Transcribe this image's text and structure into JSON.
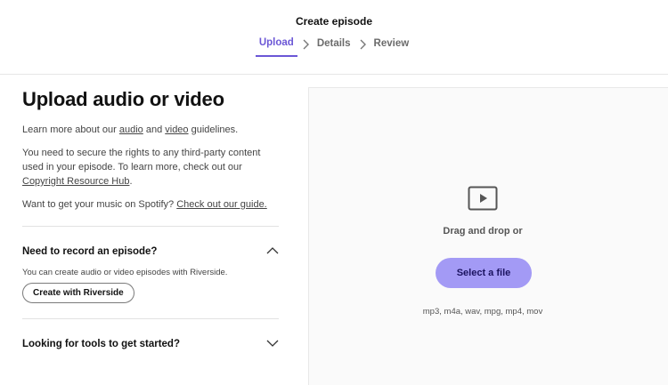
{
  "header": {
    "title": "Create episode",
    "steps": [
      {
        "label": "Upload",
        "active": true
      },
      {
        "label": "Details",
        "active": false
      },
      {
        "label": "Review",
        "active": false
      }
    ]
  },
  "left": {
    "heading": "Upload audio or video",
    "guidelines": {
      "prefix": "Learn more about our ",
      "audio_link": "audio",
      "middle": " and ",
      "video_link": "video",
      "suffix": " guidelines."
    },
    "rights": {
      "text": "You need to secure the rights to any third-party content used in your episode. To learn more, check out our ",
      "link": "Copyright Resource Hub",
      "suffix": "."
    },
    "music": {
      "text": "Want to get your music on Spotify? ",
      "link": "Check out our guide."
    },
    "accordion_record": {
      "title": "Need to record an episode?",
      "expanded": true,
      "body": "You can create audio or video episodes with Riverside.",
      "button": "Create with Riverside"
    },
    "accordion_tools": {
      "title": "Looking for tools to get started?",
      "expanded": false
    }
  },
  "dropzone": {
    "icon": "play-video-icon",
    "drag_text": "Drag and drop or",
    "button": "Select a file",
    "formats": "mp3, m4a, wav, mpg, mp4, mov"
  },
  "colors": {
    "accent": "#6b57d6",
    "button_fill": "#a39af5"
  }
}
